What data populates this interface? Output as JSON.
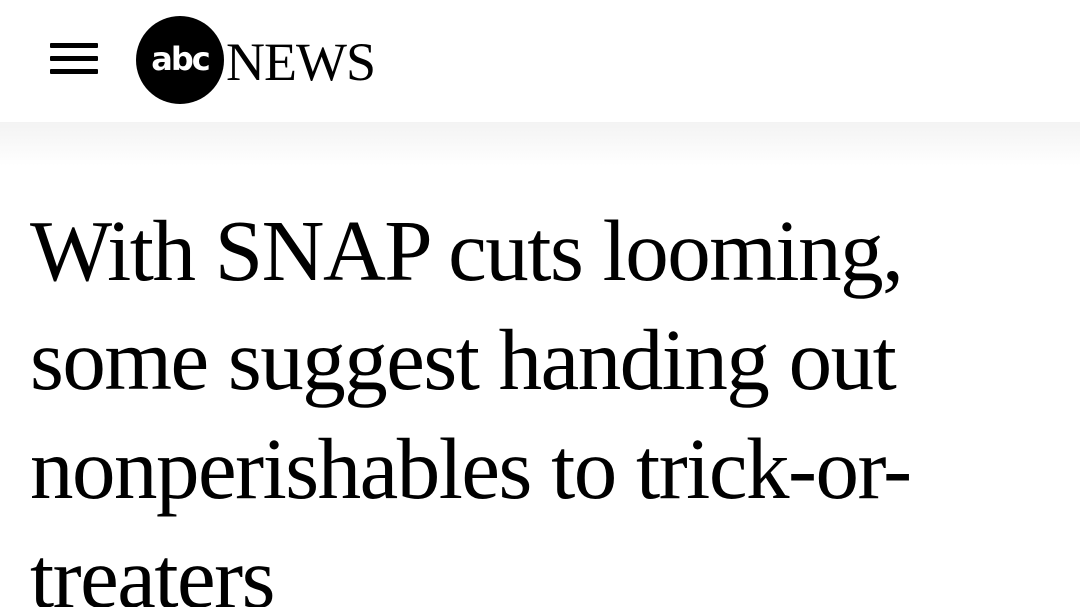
{
  "header": {
    "menu_icon": "hamburger-menu-icon",
    "logo": {
      "mark_text": "abc",
      "wordmark_text": "NEWS"
    }
  },
  "article": {
    "headline": "With SNAP cuts looming, some suggest handing out nonperishables to trick-or-treaters"
  }
}
